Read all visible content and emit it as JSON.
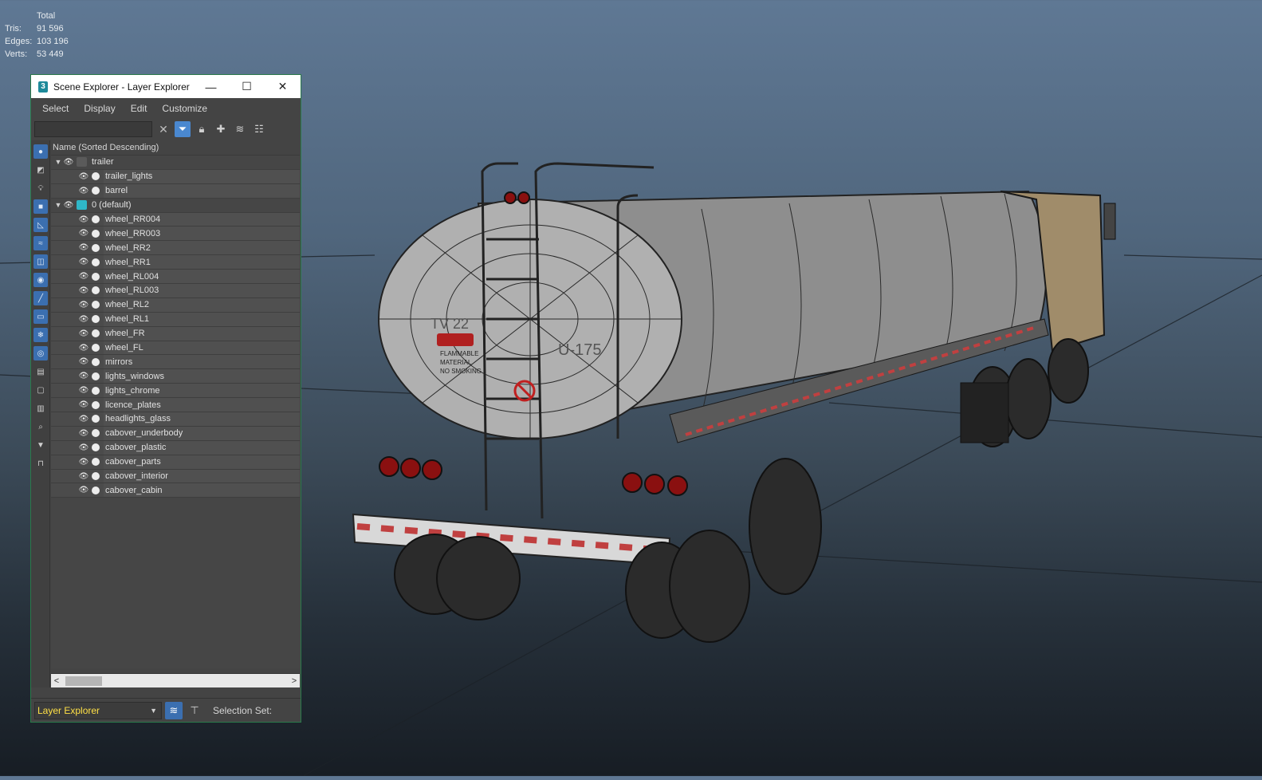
{
  "viewport_stats": {
    "total_label": "Total",
    "rows": [
      {
        "label": "Tris:",
        "value": "91 596"
      },
      {
        "label": "Edges:",
        "value": "103 196"
      },
      {
        "label": "Verts:",
        "value": "53 449"
      }
    ]
  },
  "window": {
    "title": "Scene Explorer - Layer Explorer",
    "app_icon": "3",
    "controls": {
      "minimize": "—",
      "maximize": "☐",
      "close": "✕"
    }
  },
  "menu": [
    "Select",
    "Display",
    "Edit",
    "Customize"
  ],
  "search": {
    "value": "",
    "placeholder": ""
  },
  "tree": {
    "column_header": "Name (Sorted Descending)",
    "layers": [
      {
        "name": "trailer",
        "color": "#5a5a5a",
        "children": [
          "trailer_lights",
          "barrel"
        ]
      },
      {
        "name": "0 (default)",
        "color": "#2fb7c8",
        "children": [
          "wheel_RR004",
          "wheel_RR003",
          "wheel_RR2",
          "wheel_RR1",
          "wheel_RL004",
          "wheel_RL003",
          "wheel_RL2",
          "wheel_RL1",
          "wheel_FR",
          "wheel_FL",
          "mirrors",
          "lights_windows",
          "lights_chrome",
          "licence_plates",
          "headlights_glass",
          "cabover_underbody",
          "cabover_plastic",
          "cabover_parts",
          "cabover_interior",
          "cabover_cabin"
        ]
      }
    ]
  },
  "status": {
    "explorer_dropdown": "Layer Explorer",
    "selection_set_label": "Selection Set:"
  },
  "truck_decals": {
    "tank_code": "TV 22",
    "tank_number": "U-175",
    "hazard_lines": [
      "FLAMMABLE",
      "MATERIAL",
      "NO SMOKING"
    ]
  },
  "colors": {
    "accent": "#3b6fb0",
    "dropdown_text": "#ffe046"
  }
}
